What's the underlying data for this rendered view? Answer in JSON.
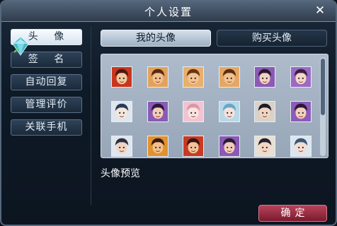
{
  "window": {
    "title": "个人设置",
    "close_icon": "close-icon"
  },
  "sidebar": {
    "items": [
      {
        "label": "头 像",
        "active": true
      },
      {
        "label": "签 名",
        "active": false
      },
      {
        "label": "自动回复",
        "active": false
      },
      {
        "label": "管理评价",
        "active": false
      },
      {
        "label": "关联手机",
        "active": false
      }
    ]
  },
  "tabs": [
    {
      "label": "我的头像",
      "active": true
    },
    {
      "label": "购买头像",
      "active": false
    }
  ],
  "avatars": [
    {
      "name": "avatar-red-warrior",
      "bg": "#c8361e",
      "hair": "#4a1a10",
      "skin": "#f1c8a0"
    },
    {
      "name": "avatar-orange-hero",
      "bg": "#e2a25c",
      "hair": "#5a2a10",
      "skin": "#f2c08e"
    },
    {
      "name": "avatar-orange-hero-2",
      "bg": "#e7b06c",
      "hair": "#6b3415",
      "skin": "#f3c495"
    },
    {
      "name": "avatar-orange-hero-3",
      "bg": "#e4a864",
      "hair": "#5d2e12",
      "skin": "#f2c292"
    },
    {
      "name": "avatar-purple-lady",
      "bg": "#8a5ab4",
      "hair": "#2a1a30",
      "skin": "#f3d2c0"
    },
    {
      "name": "avatar-purple-lady-2",
      "bg": "#9a6ac4",
      "hair": "#3a2040",
      "skin": "#f4d8c6"
    },
    {
      "name": "avatar-white-sage",
      "bg": "#dfe6ee",
      "hair": "#2a3a58",
      "skin": "#f5e6dc"
    },
    {
      "name": "avatar-purple-girl",
      "bg": "#8a5ab4",
      "hair": "#2c1a38",
      "skin": "#f2cdb8"
    },
    {
      "name": "avatar-pink-girl",
      "bg": "#f2c4d2",
      "hair": "#d89aa8",
      "skin": "#fbe4e0"
    },
    {
      "name": "avatar-blue-girl",
      "bg": "#b8d8e8",
      "hair": "#6aa6c8",
      "skin": "#f5e2dc"
    },
    {
      "name": "avatar-dark-lady",
      "bg": "#d8d2c8",
      "hair": "#1c1c28",
      "skin": "#f2d4c2"
    },
    {
      "name": "avatar-purple-lady-3",
      "bg": "#8c5cb8",
      "hair": "#2a1a36",
      "skin": "#f3d0be"
    },
    {
      "name": "avatar-partial-1",
      "bg": "#dfe6ee",
      "hair": "#2a3040",
      "skin": "#f2d2c0"
    },
    {
      "name": "avatar-partial-2",
      "bg": "#e0922c",
      "hair": "#3a1a10",
      "skin": "#f2c08e"
    },
    {
      "name": "avatar-partial-3",
      "bg": "#c83a24",
      "hair": "#3a1510",
      "skin": "#f0c49a"
    },
    {
      "name": "avatar-partial-4",
      "bg": "#8a5ab4",
      "hair": "#2c1a38",
      "skin": "#f2cdb8"
    },
    {
      "name": "avatar-partial-5",
      "bg": "#e8e0d4",
      "hair": "#282030",
      "skin": "#f3d6c4"
    },
    {
      "name": "avatar-partial-6",
      "bg": "#dce6ee",
      "hair": "#3a5878",
      "skin": "#f4dcd0"
    }
  ],
  "preview": {
    "label": "头像预览"
  },
  "confirm": {
    "label": "确定"
  },
  "colors": {
    "accent_red": "#8e2236",
    "tab_active": "#c8d4e2",
    "panel_bg": "#0f1a27"
  }
}
